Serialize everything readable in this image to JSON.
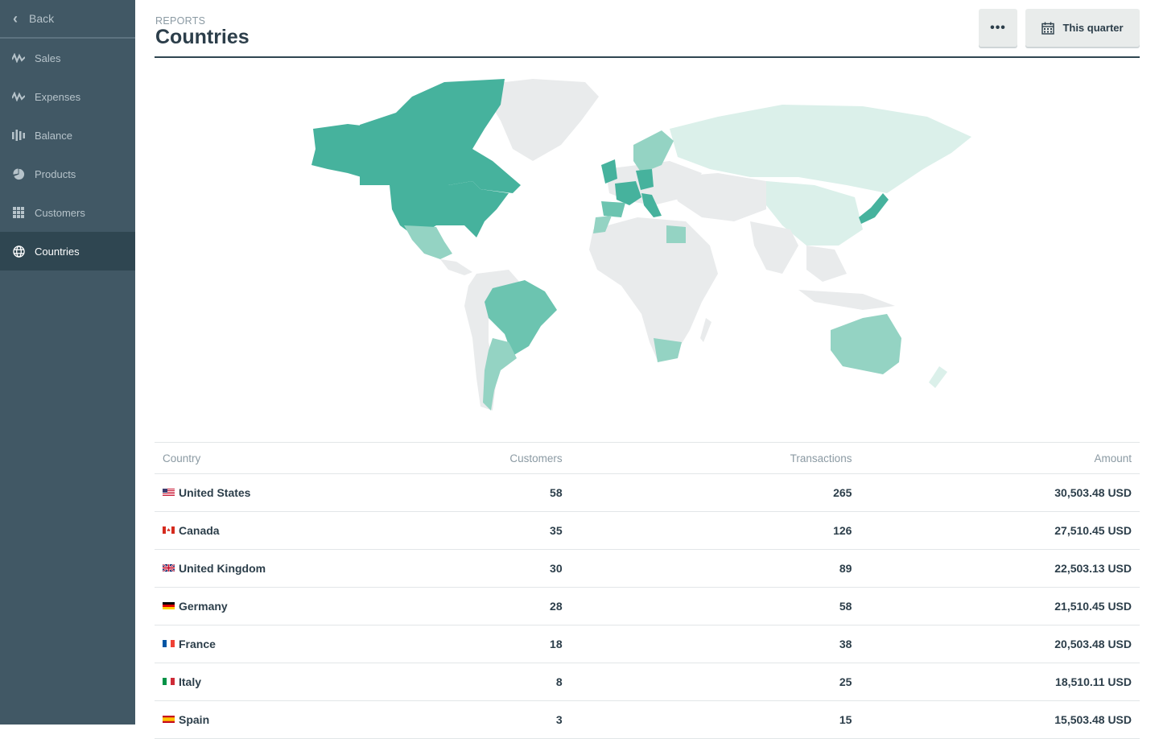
{
  "sidebar": {
    "back_label": "Back",
    "items": [
      {
        "label": "Sales",
        "icon": "activity-icon"
      },
      {
        "label": "Expenses",
        "icon": "activity-icon"
      },
      {
        "label": "Balance",
        "icon": "bars-icon"
      },
      {
        "label": "Products",
        "icon": "pie-chart-icon"
      },
      {
        "label": "Customers",
        "icon": "grid-icon"
      },
      {
        "label": "Countries",
        "icon": "globe-icon",
        "active": true
      }
    ]
  },
  "header": {
    "eyebrow": "REPORTS",
    "title": "Countries",
    "more_label": "•••",
    "period_label": "This quarter"
  },
  "colors": {
    "sidebar_bg": "#415865",
    "sidebar_active": "#2f4651",
    "map_dark": "#46b29d",
    "map_mid": "#6cc4b0",
    "map_light": "#94d3c3",
    "map_pale": "#dbf0ea",
    "map_none": "#e9ebec"
  },
  "table": {
    "headers": {
      "country": "Country",
      "customers": "Customers",
      "transactions": "Transactions",
      "amount": "Amount"
    },
    "rows": [
      {
        "country": "United States",
        "flag": "us",
        "customers": "58",
        "transactions": "265",
        "amount": "30,503.48 USD"
      },
      {
        "country": "Canada",
        "flag": "ca",
        "customers": "35",
        "transactions": "126",
        "amount": "27,510.45 USD"
      },
      {
        "country": "United Kingdom",
        "flag": "gb",
        "customers": "30",
        "transactions": "89",
        "amount": "22,503.13 USD"
      },
      {
        "country": "Germany",
        "flag": "de",
        "customers": "28",
        "transactions": "58",
        "amount": "21,510.45 USD"
      },
      {
        "country": "France",
        "flag": "fr",
        "customers": "18",
        "transactions": "38",
        "amount": "20,503.48 USD"
      },
      {
        "country": "Italy",
        "flag": "it",
        "customers": "8",
        "transactions": "25",
        "amount": "18,510.11 USD"
      },
      {
        "country": "Spain",
        "flag": "es",
        "customers": "3",
        "transactions": "15",
        "amount": "15,503.48 USD"
      }
    ]
  }
}
